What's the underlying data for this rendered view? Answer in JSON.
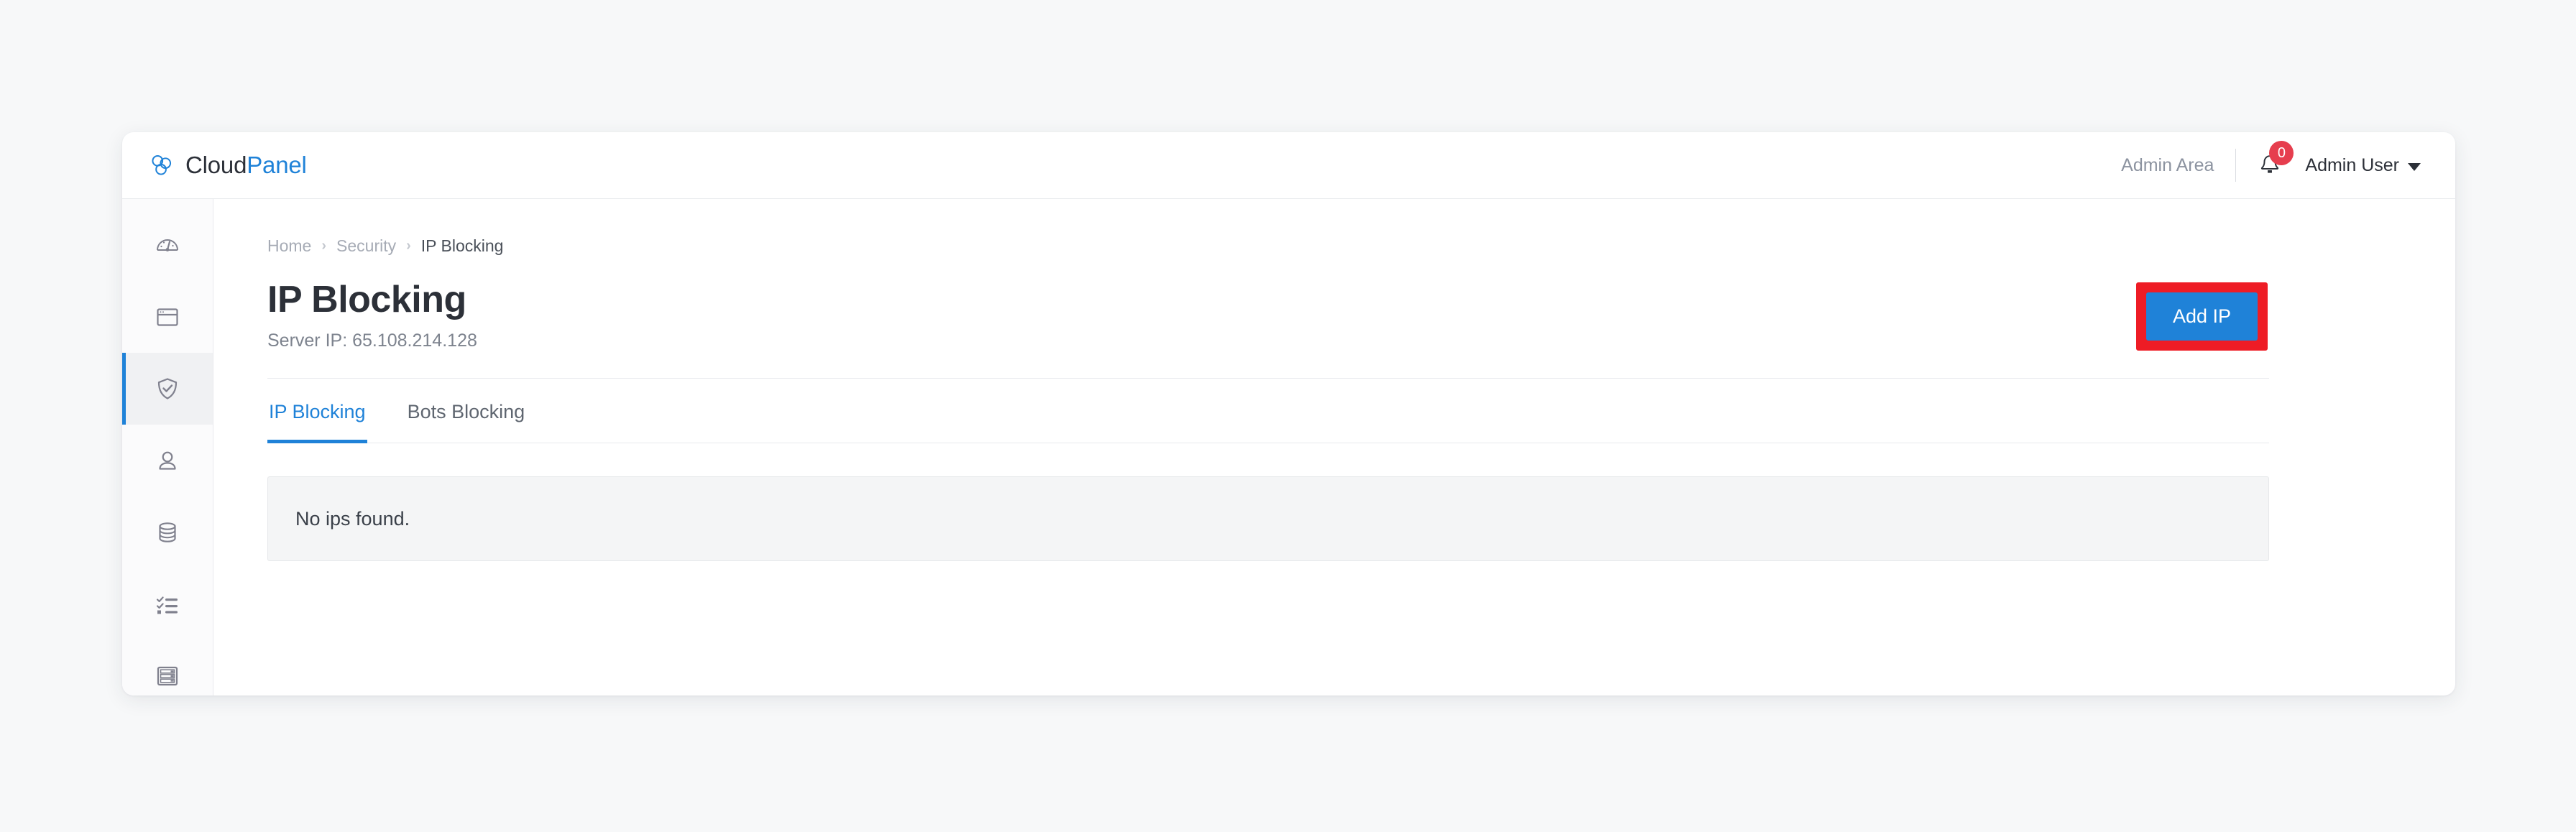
{
  "brand": {
    "name_first": "Cloud",
    "name_second": "Panel",
    "icon": "cloudpanel-logo-icon",
    "color_primary": "#1f82d8",
    "color_dark": "#2c3038"
  },
  "topbar": {
    "admin_area_label": "Admin Area",
    "notifications": {
      "icon": "bell-icon",
      "badge_count": "0",
      "badge_color": "#e63e4e"
    },
    "user": {
      "name": "Admin User",
      "caret_icon": "chevron-down-icon"
    }
  },
  "sidebar": {
    "items": [
      {
        "id": "dashboard",
        "icon": "gauge-icon",
        "active": false
      },
      {
        "id": "sites",
        "icon": "browser-window-icon",
        "active": false
      },
      {
        "id": "security",
        "icon": "shield-check-icon",
        "active": true
      },
      {
        "id": "users",
        "icon": "user-icon",
        "active": false
      },
      {
        "id": "databases",
        "icon": "database-icon",
        "active": false
      },
      {
        "id": "cron-jobs",
        "icon": "checklist-icon",
        "active": false
      },
      {
        "id": "server",
        "icon": "server-rack-icon",
        "active": false
      }
    ],
    "active_indicator_color": "#1f82d8"
  },
  "breadcrumb": {
    "separator": "›",
    "items": [
      {
        "label": "Home",
        "current": false
      },
      {
        "label": "Security",
        "current": false
      },
      {
        "label": "IP Blocking",
        "current": true
      }
    ]
  },
  "page": {
    "title": "IP Blocking",
    "subtitle": "Server IP: 65.108.214.128",
    "server_ip": "65.108.214.128"
  },
  "actions": {
    "add_ip": {
      "label": "Add IP",
      "background": "#1f82d8",
      "highlight_color": "#ee1c25",
      "highlighted": true
    }
  },
  "tabs": [
    {
      "label": "IP Blocking",
      "active": true
    },
    {
      "label": "Bots Blocking",
      "active": false
    }
  ],
  "content": {
    "empty_message": "No ips found."
  }
}
